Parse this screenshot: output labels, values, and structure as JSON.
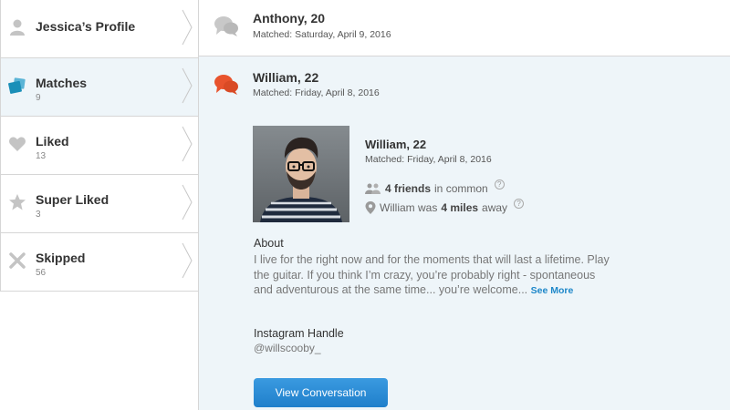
{
  "sidebar": {
    "items": [
      {
        "label": "Jessica’s Profile",
        "icon": "user-icon"
      },
      {
        "label": "Matches",
        "count": "9",
        "icon": "matches-icon"
      },
      {
        "label": "Liked",
        "count": "13",
        "icon": "heart-icon"
      },
      {
        "label": "Super Liked",
        "count": "3",
        "icon": "star-icon"
      },
      {
        "label": "Skipped",
        "count": "56",
        "icon": "x-icon"
      }
    ]
  },
  "conversations": [
    {
      "name": "Anthony, 20",
      "date": "Matched: Saturday, April 9, 2016",
      "icon": "chat-bubbles-gray-icon"
    },
    {
      "name": "William, 22",
      "date": "Matched: Friday, April 8, 2016",
      "icon": "chat-bubbles-orange-icon"
    }
  ],
  "detail": {
    "name": "William, 22",
    "date": "Matched: Friday, April 8, 2016",
    "friends_count": "4 friends",
    "friends_suffix": "in common",
    "distance_prefix": "William was",
    "distance_value": "4 miles",
    "distance_suffix": "away",
    "help_glyph": "?",
    "about_title": "About",
    "about_text": "I live for the right now and for the moments that will last a lifetime. Play the guitar. If you think I’m crazy, you’re probably right - spontaneous and adventurous at the same time... you’re welcome...",
    "see_more": "See More",
    "instagram_title": "Instagram Handle",
    "instagram_handle": "@willscooby_",
    "button_label": "View Conversation"
  },
  "colors": {
    "accent": "#1d87c9",
    "active_bg": "#eef5f9",
    "orange": "#e8532d",
    "teal": "#1a8fb8"
  }
}
